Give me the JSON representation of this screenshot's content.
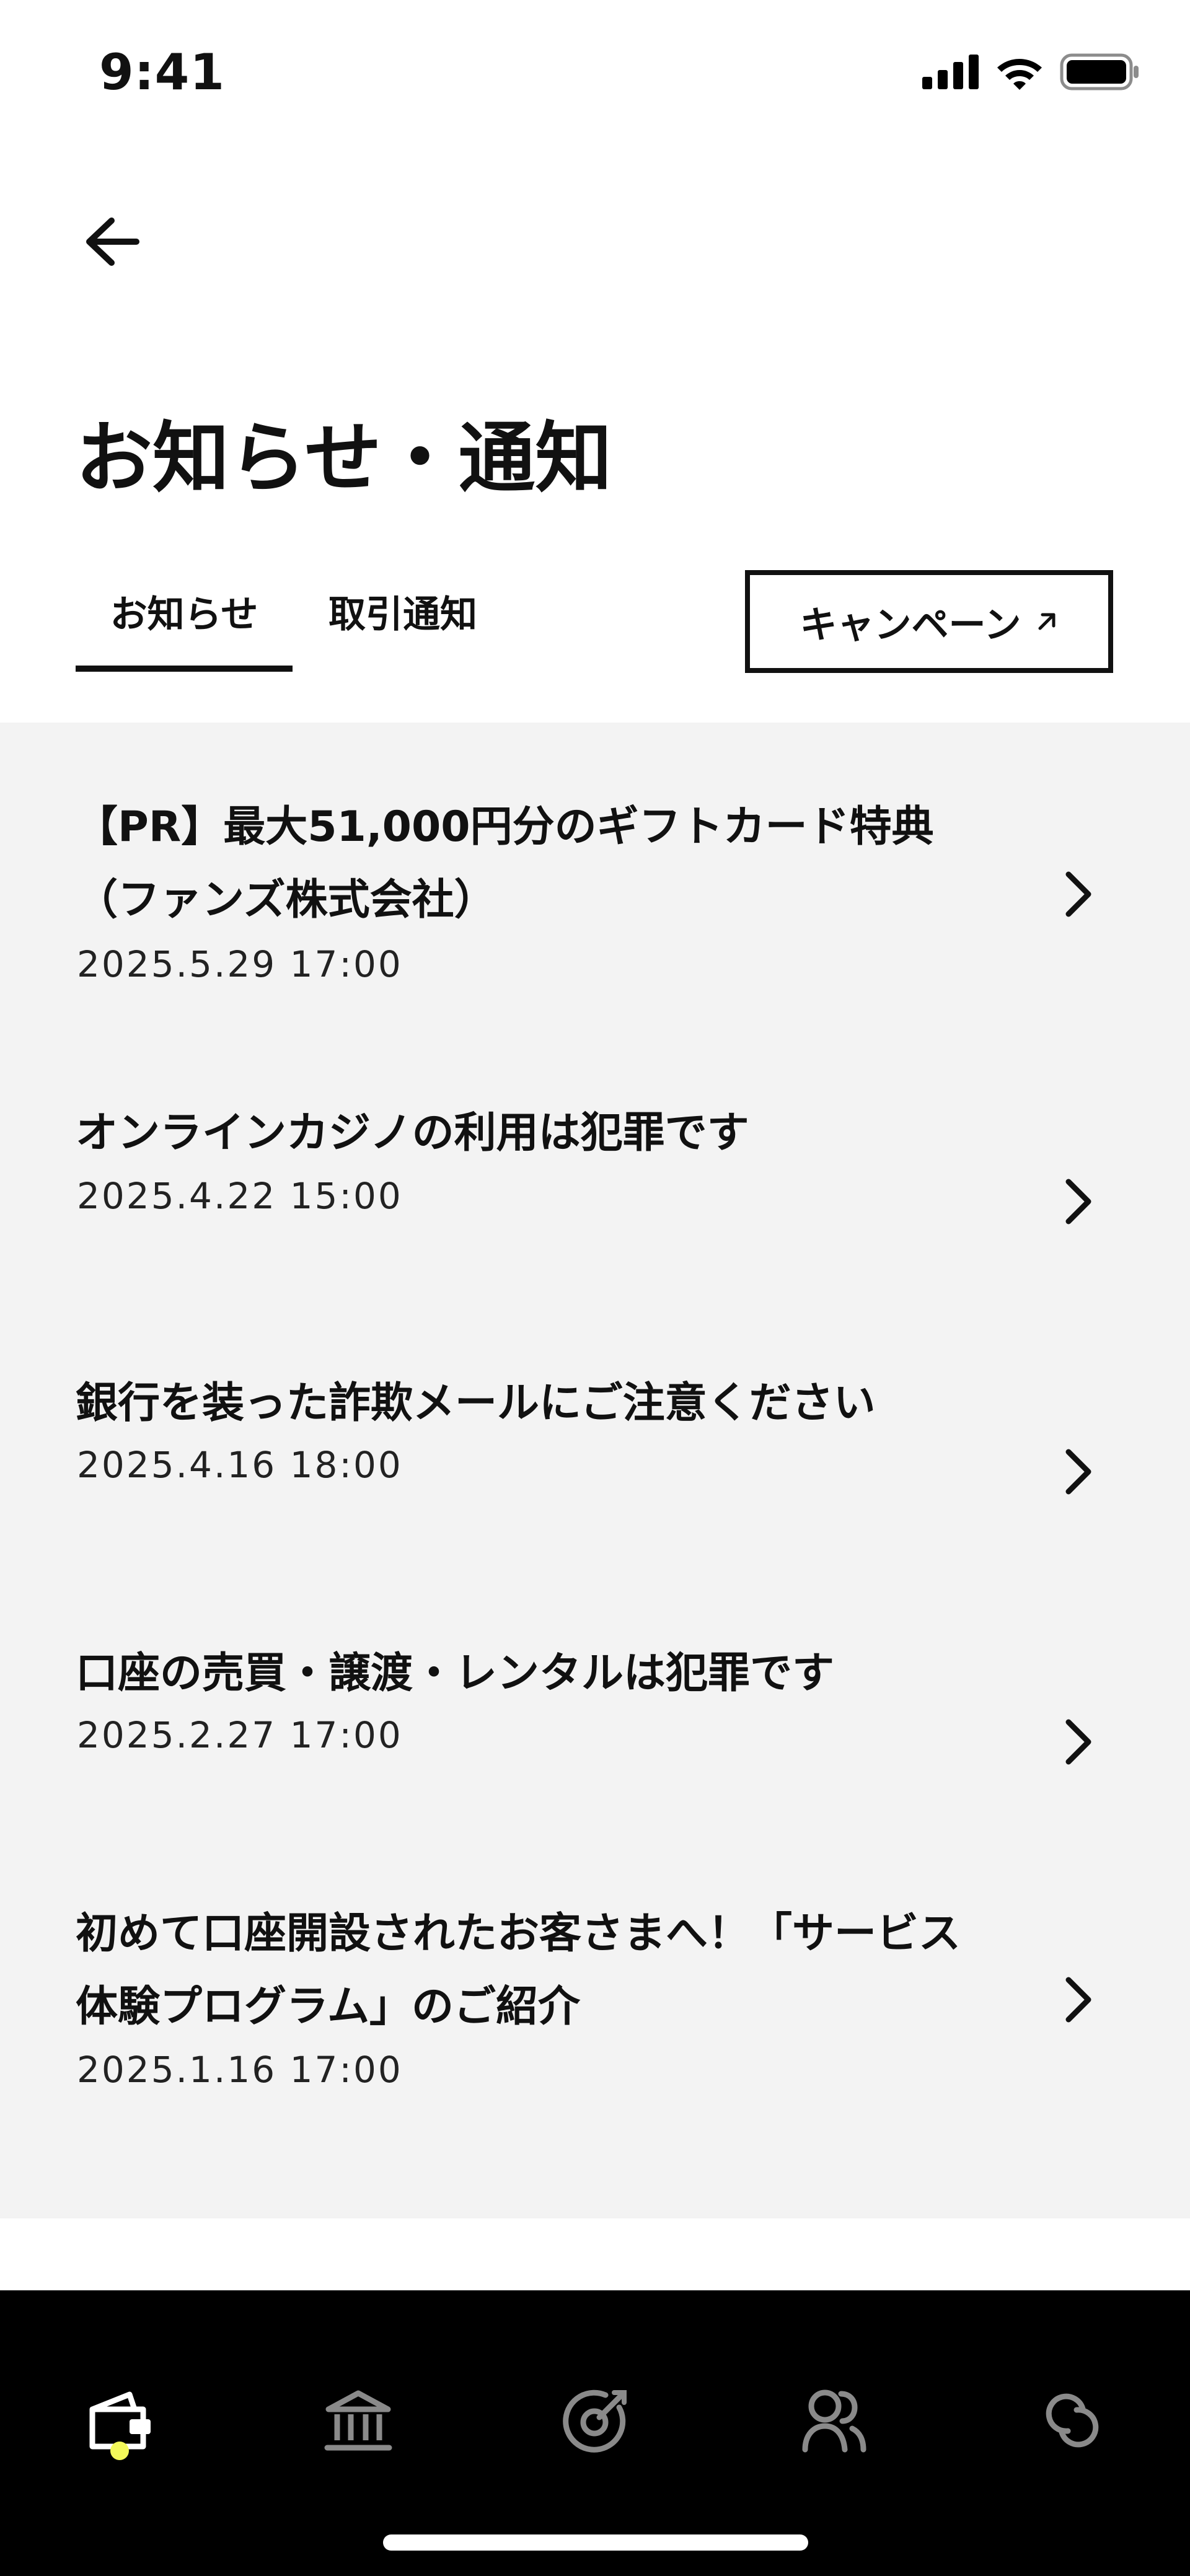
{
  "status_bar": {
    "time": "9:41"
  },
  "header": {
    "title": "お知らせ・通知"
  },
  "tabs": [
    {
      "label": "お知らせ",
      "active": true
    },
    {
      "label": "取引通知",
      "active": false
    }
  ],
  "campaign_button": {
    "label": "キャンペーン",
    "icon": "external-link-arrow-icon"
  },
  "notices": [
    {
      "title": "【PR】最大51,000円分のギフトカード特典\n（ファンズ株式会社）",
      "date": "2025.5.29 17:00"
    },
    {
      "title": "オンラインカジノの利用は犯罪です",
      "date": "2025.4.22 15:00"
    },
    {
      "title": "銀行を装った詐欺メールにご注意ください",
      "date": "2025.4.16 18:00"
    },
    {
      "title": "口座の売買・譲渡・レンタルは犯罪です",
      "date": "2025.2.27 17:00"
    },
    {
      "title": "初めて口座開設されたお客さまへ！「サービス\n体験プログラム」のご紹介",
      "date": "2025.1.16 17:00"
    }
  ],
  "bottom_nav": {
    "items": [
      {
        "icon": "wallet-icon",
        "active": true
      },
      {
        "icon": "bank-icon",
        "active": false
      },
      {
        "icon": "target-icon",
        "active": false
      },
      {
        "icon": "people-icon",
        "active": false
      },
      {
        "icon": "link-icon",
        "active": false
      }
    ]
  },
  "colors": {
    "list_background": "#f3f3f3",
    "nav_background": "#000000",
    "nav_active_dot": "#f3f85a",
    "nav_inactive_icon": "#8a8a8a",
    "text": "#111111"
  }
}
